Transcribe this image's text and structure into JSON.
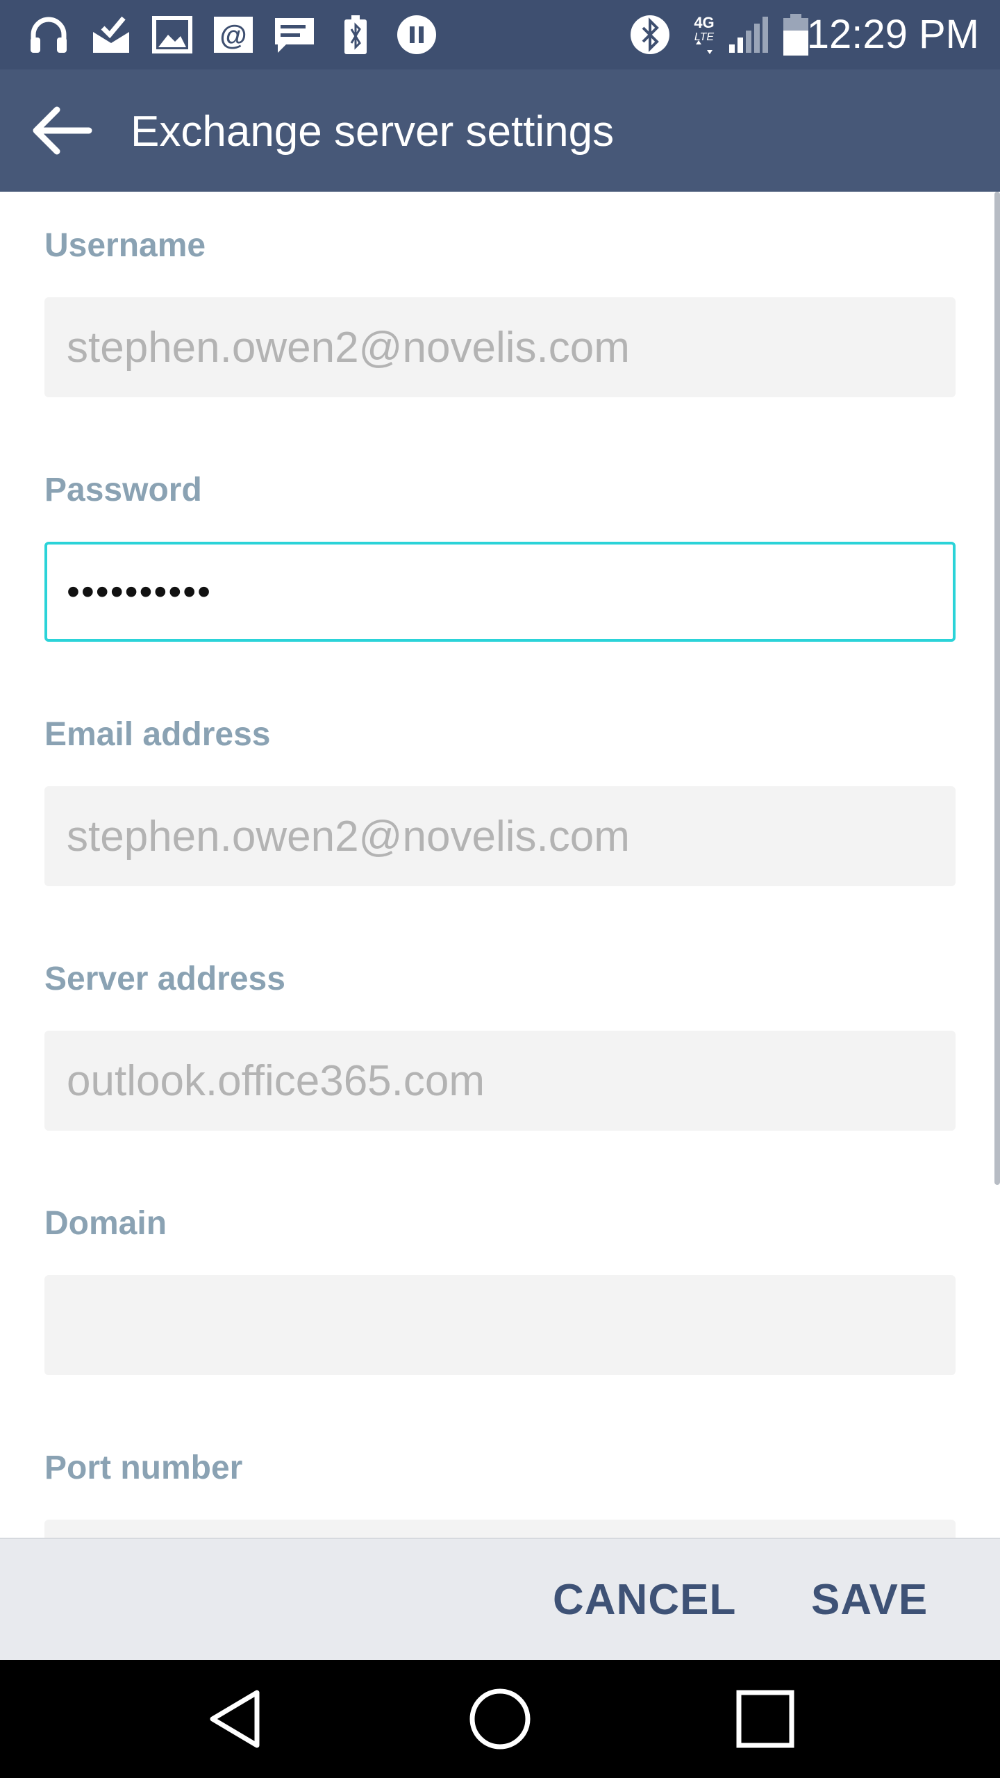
{
  "status_bar": {
    "time": "12:29 PM",
    "network_label": "4G",
    "network_sub_label": "LTE",
    "left_icons": [
      "headphones-icon",
      "mail-check-icon",
      "image-icon",
      "at-sign-icon",
      "message-icon",
      "battery-bluetooth-icon",
      "pause-icon"
    ],
    "right_icons": [
      "bluetooth-icon",
      "lte-icon",
      "signal-icon",
      "battery-icon"
    ]
  },
  "app_bar": {
    "title": "Exchange server settings",
    "back_icon": "back-arrow-icon"
  },
  "form": {
    "username": {
      "label": "Username",
      "value": "stephen.owen2@novelis.com"
    },
    "password": {
      "label": "Password",
      "value": "••••••••••"
    },
    "email": {
      "label": "Email address",
      "value": "stephen.owen2@novelis.com"
    },
    "server": {
      "label": "Server address",
      "value": "outlook.office365.com"
    },
    "domain": {
      "label": "Domain",
      "value": ""
    },
    "port": {
      "label": "Port number",
      "value": ""
    }
  },
  "actions": {
    "cancel_label": "CANCEL",
    "save_label": "SAVE"
  },
  "nav": {
    "icons": [
      "back-triangle-icon",
      "home-circle-icon",
      "recents-square-icon"
    ]
  },
  "colors": {
    "status_bar": "#3e4f70",
    "app_bar": "#475878",
    "label": "#8aa2b3",
    "active_border": "#2bd3d8",
    "action_text": "#3e5276"
  }
}
